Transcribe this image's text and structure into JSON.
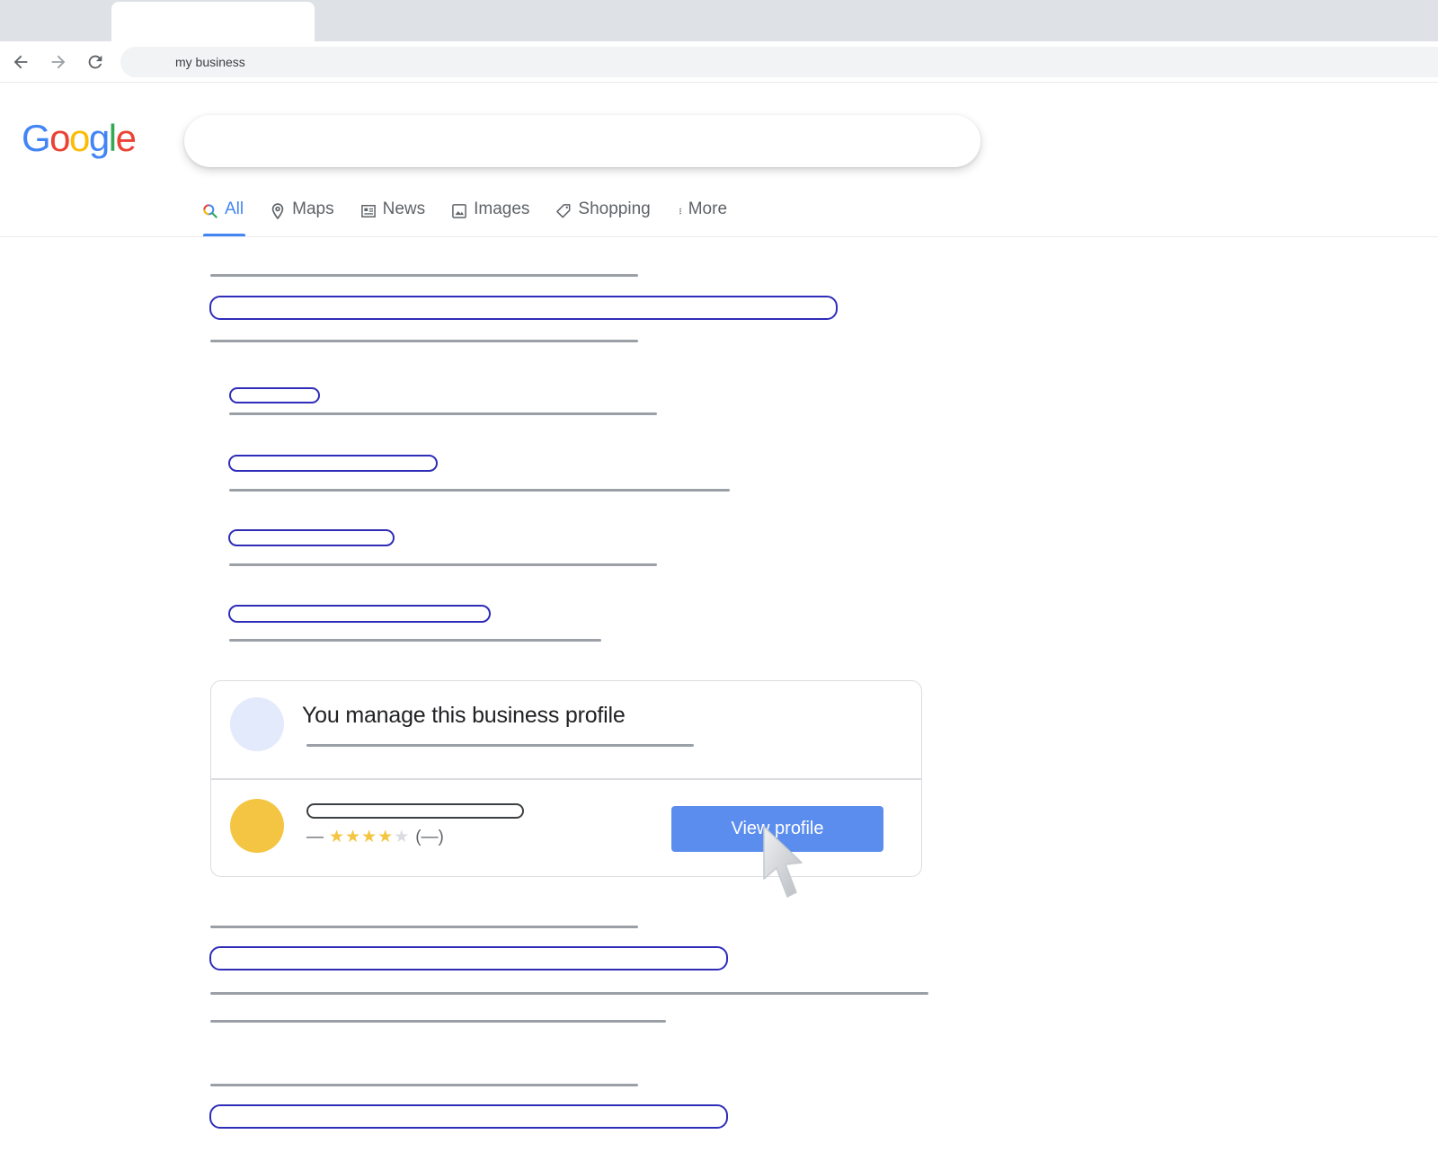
{
  "browser": {
    "address_text": "my business",
    "back_icon": "back-arrow-icon",
    "forward_icon": "forward-arrow-icon",
    "reload_icon": "reload-icon"
  },
  "logo": {
    "text": "Google",
    "colors": [
      "#4285f4",
      "#ea4335",
      "#fbbc05",
      "#4285f4",
      "#34a853",
      "#ea4335"
    ]
  },
  "search_tabs": [
    {
      "label": "All",
      "icon": "search-icon",
      "active": true
    },
    {
      "label": "Maps",
      "icon": "map-pin-icon",
      "active": false
    },
    {
      "label": "News",
      "icon": "newspaper-icon",
      "active": false
    },
    {
      "label": "Images",
      "icon": "image-icon",
      "active": false
    },
    {
      "label": "Shopping",
      "icon": "tag-icon",
      "active": false
    },
    {
      "label": "More",
      "icon": "more-vert-icon",
      "active": false
    }
  ],
  "business_card": {
    "title": "You manage this business profile",
    "rating_prefix": "—",
    "rating_stars": 4,
    "rating_max": 5,
    "rating_count": "(—)",
    "view_button_label": "View profile"
  },
  "colors": {
    "accent": "#4285f4",
    "link_outline": "#2f2db8",
    "button": "#5b8def",
    "star": "#f4c542"
  }
}
